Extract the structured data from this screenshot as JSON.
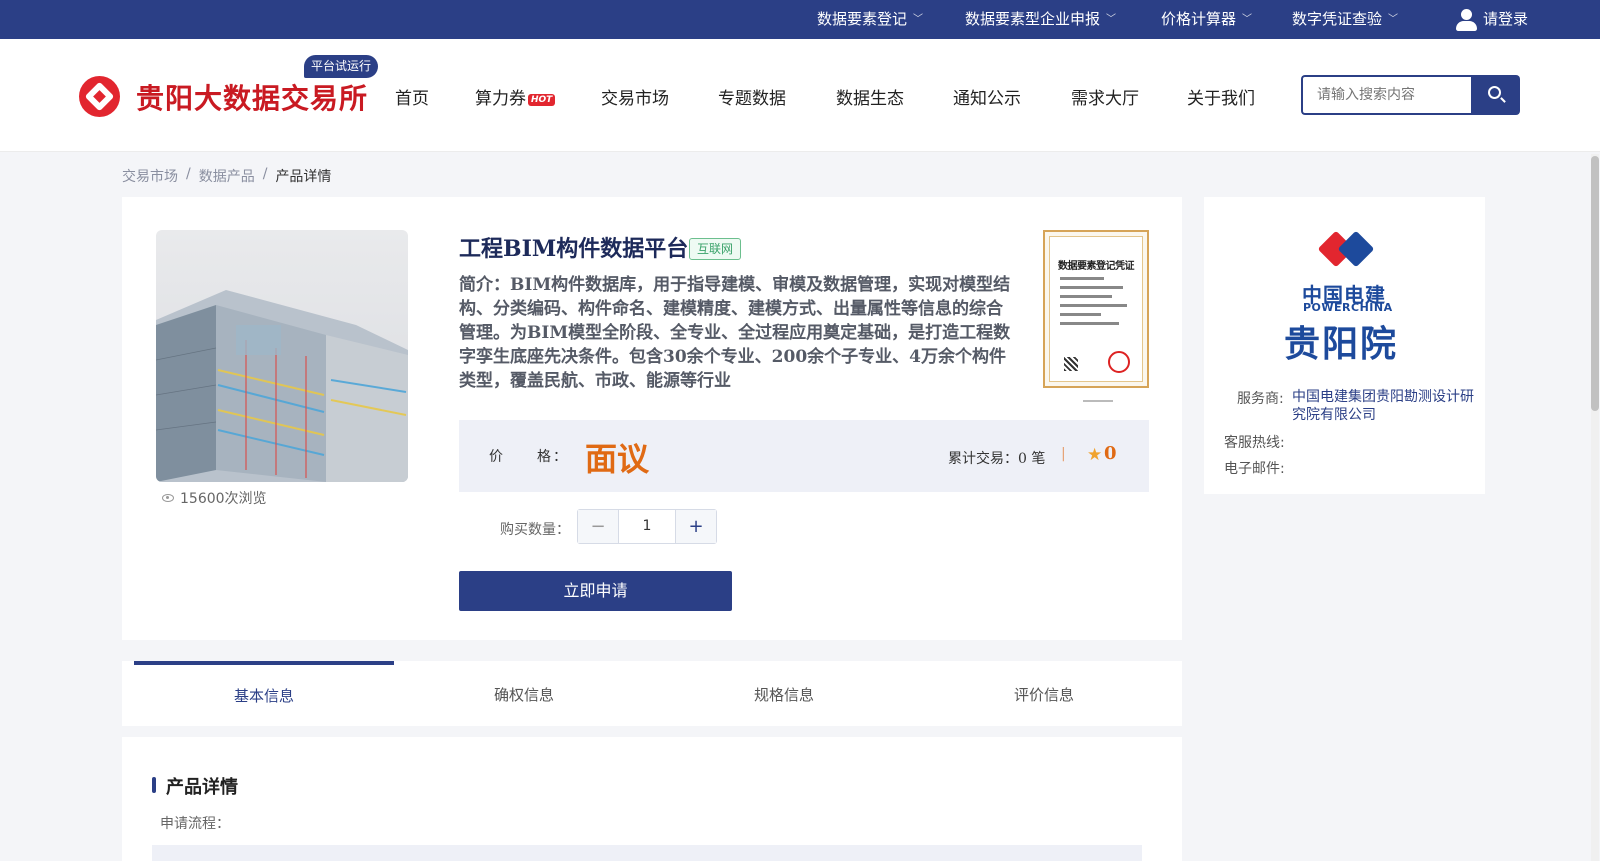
{
  "topbar": {
    "items": [
      {
        "label": "数据要素登记"
      },
      {
        "label": "数据要素型企业申报"
      },
      {
        "label": "价格计算器"
      },
      {
        "label": "数字凭证查验"
      }
    ],
    "login_label": "请登录"
  },
  "header": {
    "logo_text": "贵阳大数据交易所",
    "badge": "平台试运行",
    "nav": [
      {
        "label": "首页"
      },
      {
        "label": "算力券",
        "badge": "HOT"
      },
      {
        "label": "交易市场"
      },
      {
        "label": "专题数据"
      },
      {
        "label": "数据生态"
      },
      {
        "label": "通知公示"
      },
      {
        "label": "需求大厅"
      },
      {
        "label": "关于我们"
      }
    ],
    "search_placeholder": "请输入搜索内容"
  },
  "breadcrumb": [
    "交易市场",
    "数据产品",
    "产品详情"
  ],
  "product": {
    "title": "工程BIM构件数据平台",
    "tag": "互联网",
    "description": "简介：BIM构件数据库，用于指导建模、审模及数据管理，实现对模型结构、分类编码、构件命名、建模精度、建模方式、出量属性等信息的综合管理。为BIM模型全阶段、全专业、全过程应用奠定基础，是打造工程数字孪生底座先决条件。包含30余个专业、200余个子专业、4万余个构件类型，覆盖民航、市政、能源等行业",
    "views": "15600次浏览",
    "certificate_title": "数据要素登记凭证",
    "price_label": "价　　格：",
    "price_value": "面议",
    "trade_text": "累计交易：0 笔",
    "separator": "|",
    "rating": "0",
    "qty_label": "购买数量：",
    "qty_value": "1",
    "apply_label": "立即申请"
  },
  "vendor": {
    "logo_cn": "中国电建",
    "logo_en": "POWERCHINA",
    "logo_org": "贵阳院",
    "provider_label": "服务商:",
    "provider_value": "中国电建集团贵阳勘测设计研究院有限公司",
    "hotline_label": "客服热线:",
    "email_label": "电子邮件:"
  },
  "tabs": [
    {
      "label": "基本信息"
    },
    {
      "label": "确权信息"
    },
    {
      "label": "规格信息"
    },
    {
      "label": "评价信息"
    }
  ],
  "details": {
    "title": "产品详情",
    "sub": "申请流程："
  },
  "colors": {
    "primary": "#2b3f86",
    "brand_red": "#e2262f",
    "price_orange": "#e06a14"
  }
}
